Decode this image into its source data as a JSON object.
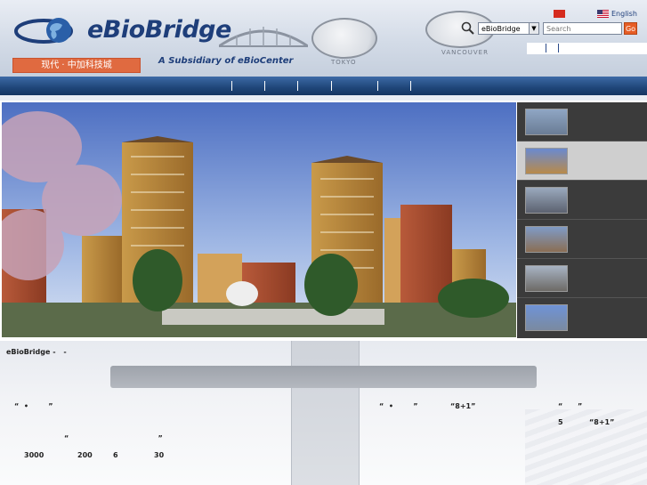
{
  "header": {
    "brand": "eBioBridge",
    "slogan": "现代 · 中加科技城",
    "subsidiary": "A Subsidiary of eBioCenter",
    "clock_labels": [
      "TOKYO",
      "VANCOUVER"
    ],
    "lang_english": "English"
  },
  "search": {
    "select_value": "eBioBridge",
    "placeholder": "Search",
    "go_label": "Go"
  },
  "nav": {
    "separators": 6
  },
  "gallery": {
    "thumbnails": [
      "thumbnail-1",
      "thumbnail-2",
      "thumbnail-3",
      "thumbnail-4",
      "thumbnail-5",
      "thumbnail-6"
    ],
    "active_index": 1
  },
  "content": {
    "site_name": "eBioBridge -",
    "dash": "-",
    "left_text": [
      {
        "id": "q1",
        "text": "“  •        ”"
      },
      {
        "id": "q2",
        "text": "“                                    ”"
      },
      {
        "id": "n1",
        "text": "3000"
      },
      {
        "id": "n2",
        "text": "200"
      },
      {
        "id": "n3",
        "text": "6"
      },
      {
        "id": "n4",
        "text": "30"
      }
    ],
    "right_text": [
      {
        "id": "r1",
        "text": "“  •        ”"
      },
      {
        "id": "r2",
        "text": "“8+1”"
      },
      {
        "id": "r3",
        "text": "“      ”"
      },
      {
        "id": "r4",
        "text": "5"
      },
      {
        "id": "r5",
        "text": "“8+1”"
      }
    ]
  },
  "colors": {
    "nav_blue": "#1f4679",
    "brand_blue": "#1e3e7a",
    "go_orange": "#e65d25",
    "slogan_orange": "#e06a40",
    "thumb_panel": "#3b3b3b"
  }
}
